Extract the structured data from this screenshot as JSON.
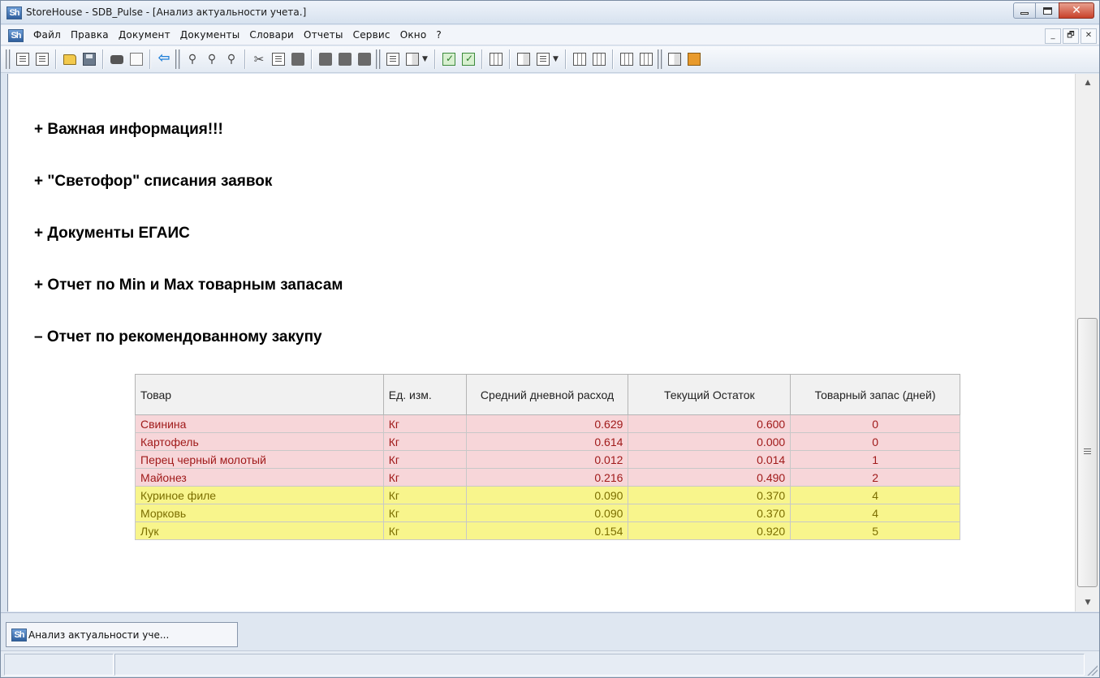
{
  "window": {
    "app_logo": "Sh",
    "title": "StoreHouse - SDB_Pulse - [Анализ актуальности учета.]",
    "buttons": {
      "minimize_icon": "minimize-icon",
      "maximize_icon": "maximize-icon",
      "close_icon": "close-icon",
      "close_glyph": "✕"
    }
  },
  "menu": {
    "app_logo": "Sh",
    "items": [
      "Файл",
      "Правка",
      "Документ",
      "Документы",
      "Словари",
      "Отчеты",
      "Сервис",
      "Окно",
      "?"
    ],
    "mdi_buttons": [
      "_",
      "🗗",
      "✕"
    ]
  },
  "toolbar": {
    "icons": [
      "document-icon",
      "document-settings-icon",
      "open-folder-icon",
      "save-icon",
      "print-icon",
      "print-preview-icon",
      "back-arrow-icon",
      "find-icon",
      "find-next-icon",
      "find-replace-icon",
      "cut-icon",
      "copy-icon",
      "paste-icon",
      "block-icon",
      "block-2-icon",
      "block-3-icon",
      "doc-list-icon",
      "doc-columns-icon",
      "check-icon",
      "check-2-icon",
      "grid-icon",
      "doc-detail-icon",
      "doc-add-icon",
      "table-icon",
      "table-add-icon",
      "table-2-icon",
      "table-add-2-icon",
      "chart-icon",
      "package-icon"
    ]
  },
  "content": {
    "sections": [
      {
        "label": "+ Важная информация!!!",
        "expanded": false
      },
      {
        "label": "+ \"Светофор\" списания заявок",
        "expanded": false
      },
      {
        "label": "+ Документы ЕГАИС",
        "expanded": false
      },
      {
        "label": "+ Отчет по Min и Max товарным запасам",
        "expanded": false
      },
      {
        "label": "– Отчет по рекомендованному закупу",
        "expanded": true
      }
    ],
    "table": {
      "headers": [
        "Товар",
        "Ед. изм.",
        "Средний дневной расход",
        "Текущий Остаток",
        "Товарный запас (дней)"
      ],
      "rows": [
        {
          "status": "red",
          "cells": [
            "Свинина",
            "Кг",
            "0.629",
            "0.600",
            "0"
          ]
        },
        {
          "status": "red",
          "cells": [
            "Картофель",
            "Кг",
            "0.614",
            "0.000",
            "0"
          ]
        },
        {
          "status": "red",
          "cells": [
            "Перец черный молотый",
            "Кг",
            "0.012",
            "0.014",
            "1"
          ]
        },
        {
          "status": "red",
          "cells": [
            "Майонез",
            "Кг",
            "0.216",
            "0.490",
            "2"
          ]
        },
        {
          "status": "yellow",
          "cells": [
            "Куриное филе",
            "Кг",
            "0.090",
            "0.370",
            "4"
          ]
        },
        {
          "status": "yellow",
          "cells": [
            "Морковь",
            "Кг",
            "0.090",
            "0.370",
            "4"
          ]
        },
        {
          "status": "yellow",
          "cells": [
            "Лук",
            "Кг",
            "0.154",
            "0.920",
            "5"
          ]
        }
      ]
    },
    "colors": {
      "red_row": "#f7d6d9",
      "red_text": "#a01a1a",
      "yellow_row": "#f8f58c",
      "yellow_text": "#7b6e00"
    }
  },
  "scrollbar": {
    "up": "▲",
    "down": "▼"
  },
  "tabs": [
    {
      "logo": "Sh",
      "label": "Анализ актуальности уче..."
    }
  ]
}
